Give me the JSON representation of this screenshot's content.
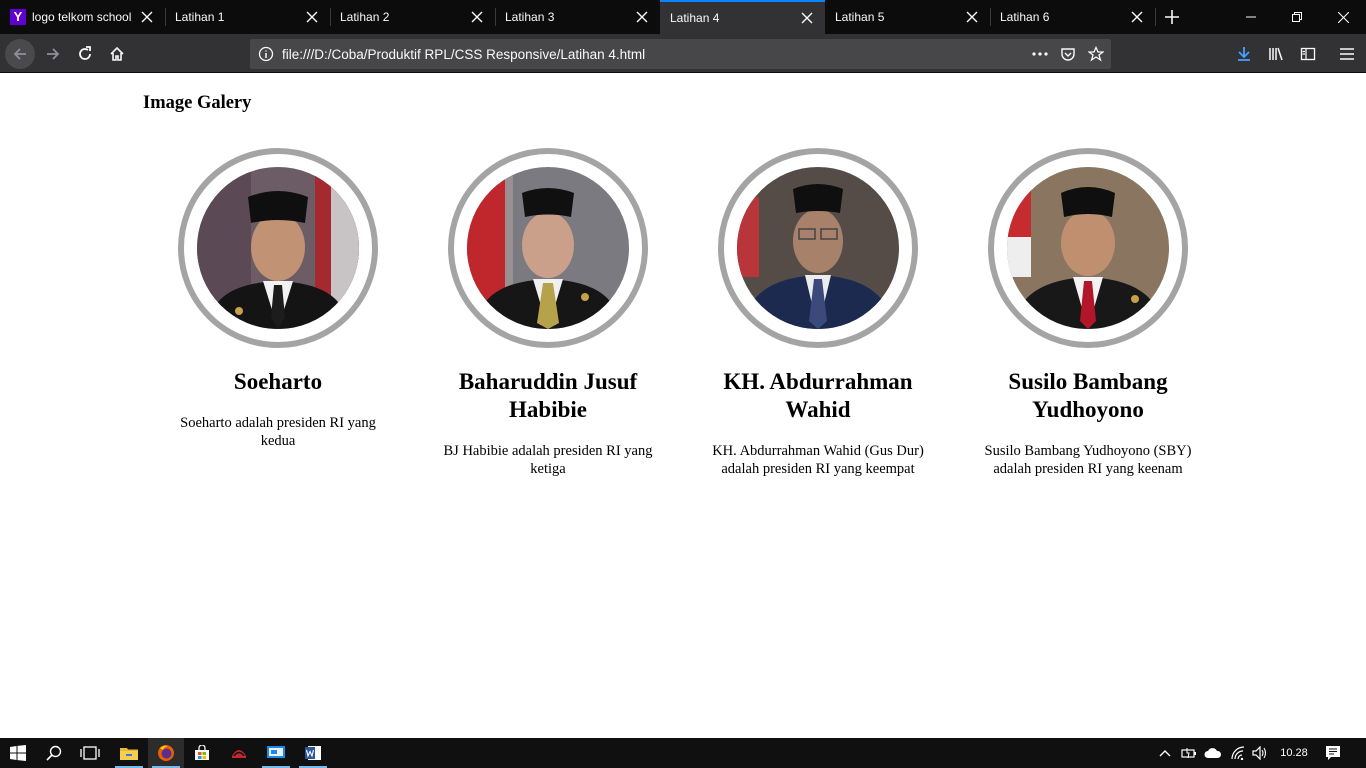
{
  "browser": {
    "tabs": [
      {
        "title": "logo telkom school",
        "favicon": "yahoo-favicon",
        "active": false
      },
      {
        "title": "Latihan 1",
        "active": false
      },
      {
        "title": "Latihan 2",
        "active": false
      },
      {
        "title": "Latihan 3",
        "active": false
      },
      {
        "title": "Latihan 4",
        "active": true
      },
      {
        "title": "Latihan 5",
        "active": false
      },
      {
        "title": "Latihan 6",
        "active": false
      }
    ],
    "url": "file:///D:/Coba/Produktif RPL/CSS Responsive/Latihan 4.html",
    "accent_color": "#0a84ff"
  },
  "page": {
    "heading": "Image Galery",
    "frame_color": "#a4a4a4",
    "cards": [
      {
        "name": "Soeharto",
        "description": "Soeharto adalah presiden RI yang kedua"
      },
      {
        "name": "Baharuddin Jusuf Habibie",
        "description": "BJ Habibie adalah presiden RI yang ketiga"
      },
      {
        "name": "KH. Abdurrahman Wahid",
        "description": "KH. Abdurrahman Wahid (Gus Dur) adalah presiden RI yang keempat"
      },
      {
        "name": "Susilo Bambang Yudhoyono",
        "description": "Susilo Bambang Yudhoyono (SBY) adalah presiden RI yang keenam"
      }
    ]
  },
  "taskbar": {
    "clock": "10.28",
    "pinned": [
      "windows-start-icon",
      "search-icon",
      "task-view-icon",
      "file-explorer-icon",
      "firefox-icon",
      "store-icon",
      "app-icon",
      "monitor-app-icon",
      "word-icon"
    ],
    "tray": [
      "chevron-up-icon",
      "battery-icon",
      "cloud-icon",
      "wifi-icon",
      "volume-icon",
      "notification-icon"
    ]
  }
}
